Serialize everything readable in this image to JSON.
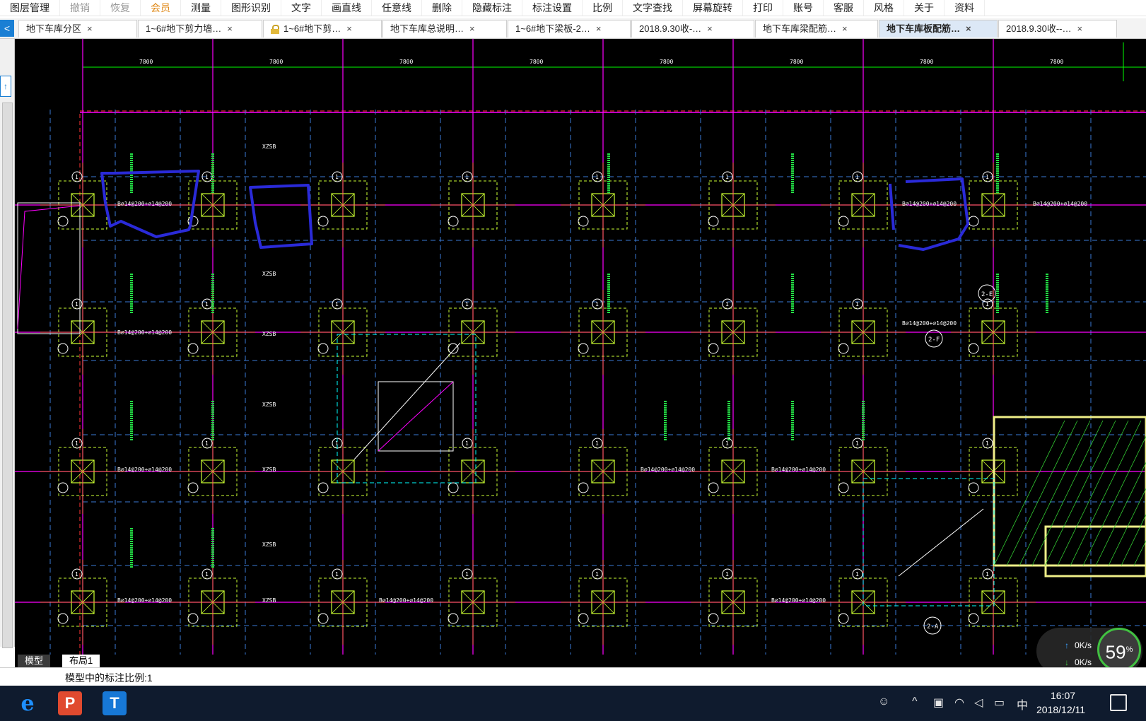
{
  "menubar": {
    "items": [
      {
        "label": "图层管理",
        "state": "normal"
      },
      {
        "label": "撤销",
        "state": "disabled"
      },
      {
        "label": "恢复",
        "state": "disabled"
      },
      {
        "label": "会员",
        "state": "vip"
      },
      {
        "label": "测量",
        "state": "normal"
      },
      {
        "label": "图形识别",
        "state": "normal"
      },
      {
        "label": "文字",
        "state": "normal"
      },
      {
        "label": "画直线",
        "state": "normal"
      },
      {
        "label": "任意线",
        "state": "normal"
      },
      {
        "label": "删除",
        "state": "normal"
      },
      {
        "label": "隐藏标注",
        "state": "normal"
      },
      {
        "label": "标注设置",
        "state": "normal"
      },
      {
        "label": "比例",
        "state": "normal"
      },
      {
        "label": "文字查找",
        "state": "normal"
      },
      {
        "label": "屏幕旋转",
        "state": "normal"
      },
      {
        "label": "打印",
        "state": "normal"
      },
      {
        "label": "账号",
        "state": "normal"
      },
      {
        "label": "客服",
        "state": "normal"
      },
      {
        "label": "风格",
        "state": "normal"
      },
      {
        "label": "关于",
        "state": "normal"
      },
      {
        "label": "资料",
        "state": "normal"
      }
    ]
  },
  "tabs": {
    "scroll_left_icon": "<",
    "close_glyph": "×",
    "items": [
      {
        "label": "地下车库分区",
        "locked": false,
        "active": false
      },
      {
        "label": "1~6#地下剪力墙…",
        "locked": false,
        "active": false
      },
      {
        "label": "1~6#地下剪…",
        "locked": true,
        "active": false
      },
      {
        "label": "地下车库总说明…",
        "locked": false,
        "active": false
      },
      {
        "label": "1~6#地下梁板-2…",
        "locked": false,
        "active": false
      },
      {
        "label": "2018.9.30收-…",
        "locked": false,
        "active": false
      },
      {
        "label": "地下车库梁配筋…",
        "locked": false,
        "active": false
      },
      {
        "label": "地下车库板配筋…",
        "locked": false,
        "active": true
      },
      {
        "label": "2018.9.30收--…",
        "locked": false,
        "active": false
      }
    ]
  },
  "drawing": {
    "dimension_label": "7800",
    "dimension_count": 8,
    "axis_bubble_label": "1",
    "axis_bubble_labels_right": [
      "2-E",
      "2-F",
      "2-A"
    ],
    "rebar_note": "B∅14@200+∅14@200",
    "slab_mark": "XZSB",
    "colors": {
      "axis": "#ff00ff",
      "grid": "#3a7ad6",
      "column": "#ccff33",
      "beam_dim": "#00ff00",
      "text_cyan": "#00ffff",
      "text_white": "#ffffff",
      "marker": "#2a2ad8",
      "hatch": "#eeee88"
    }
  },
  "layout_tabs": {
    "model": "模型",
    "layout": "布局1"
  },
  "status": {
    "text": "模型中的标注比例:1"
  },
  "speed_widget": {
    "up": "0K/s",
    "down": "0K/s",
    "percent": "59",
    "unit": "%"
  },
  "taskbar": {
    "ie_icon": "e",
    "wps_icon": "P",
    "t_icon": "T",
    "input_method": "中",
    "time": "16:07",
    "date": "2018/12/11"
  }
}
